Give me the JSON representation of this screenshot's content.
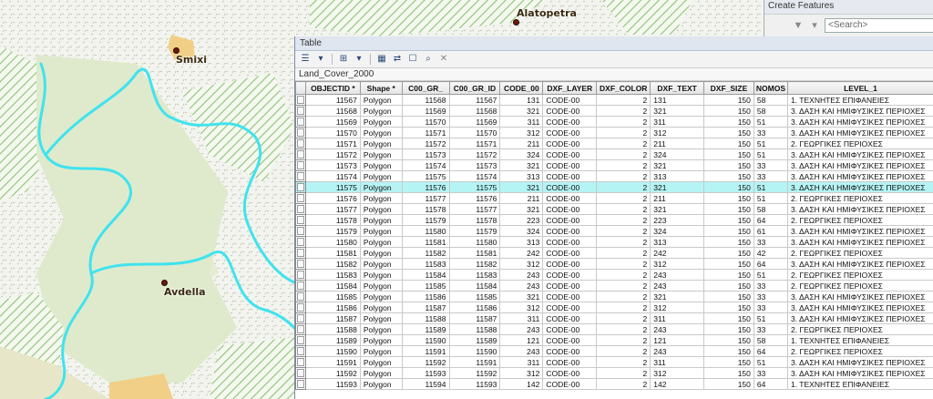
{
  "map": {
    "labels": [
      {
        "name": "Alatopetra"
      },
      {
        "name": "Smixi"
      },
      {
        "name": "Avdella"
      }
    ]
  },
  "create_features": {
    "title": "Create Features",
    "search_placeholder": "<Search>"
  },
  "table_window": {
    "title": "Table",
    "tab_name": "Land_Cover_2000",
    "highlighted_row": 8,
    "columns": [
      "OBJECTID *",
      "Shape *",
      "C00_GR_",
      "C00_GR_ID",
      "CODE_00",
      "DXF_LAYER",
      "DXF_COLOR",
      "DXF_TEXT",
      "DXF_SIZE",
      "NOMOS",
      "LEVEL_1"
    ],
    "rows": [
      [
        "11567",
        "Polygon",
        "11568",
        "11567",
        "131",
        "CODE-00",
        "2",
        "131",
        "150",
        "58",
        "1. ΤΕΧΝΗΤΕΣ ΕΠΙΦΑΝΕΙΕΣ"
      ],
      [
        "11568",
        "Polygon",
        "11569",
        "11568",
        "321",
        "CODE-00",
        "2",
        "321",
        "150",
        "58",
        "3. ΔΑΣΗ ΚΑΙ ΗΜΙΦΥΣΙΚΕΣ ΠΕΡΙΟΧΕΣ"
      ],
      [
        "11569",
        "Polygon",
        "11570",
        "11569",
        "311",
        "CODE-00",
        "2",
        "311",
        "150",
        "51",
        "3. ΔΑΣΗ ΚΑΙ ΗΜΙΦΥΣΙΚΕΣ ΠΕΡΙΟΧΕΣ"
      ],
      [
        "11570",
        "Polygon",
        "11571",
        "11570",
        "312",
        "CODE-00",
        "2",
        "312",
        "150",
        "33",
        "3. ΔΑΣΗ ΚΑΙ ΗΜΙΦΥΣΙΚΕΣ ΠΕΡΙΟΧΕΣ"
      ],
      [
        "11571",
        "Polygon",
        "11572",
        "11571",
        "211",
        "CODE-00",
        "2",
        "211",
        "150",
        "51",
        "2. ΓΕΩΡΓΙΚΕΣ ΠΕΡΙΟΧΕΣ"
      ],
      [
        "11572",
        "Polygon",
        "11573",
        "11572",
        "324",
        "CODE-00",
        "2",
        "324",
        "150",
        "51",
        "3. ΔΑΣΗ ΚΑΙ ΗΜΙΦΥΣΙΚΕΣ ΠΕΡΙΟΧΕΣ"
      ],
      [
        "11573",
        "Polygon",
        "11574",
        "11573",
        "321",
        "CODE-00",
        "2",
        "321",
        "150",
        "33",
        "3. ΔΑΣΗ ΚΑΙ ΗΜΙΦΥΣΙΚΕΣ ΠΕΡΙΟΧΕΣ"
      ],
      [
        "11574",
        "Polygon",
        "11575",
        "11574",
        "313",
        "CODE-00",
        "2",
        "313",
        "150",
        "33",
        "3. ΔΑΣΗ ΚΑΙ ΗΜΙΦΥΣΙΚΕΣ ΠΕΡΙΟΧΕΣ"
      ],
      [
        "11575",
        "Polygon",
        "11576",
        "11575",
        "321",
        "CODE-00",
        "2",
        "321",
        "150",
        "51",
        "3. ΔΑΣΗ ΚΑΙ ΗΜΙΦΥΣΙΚΕΣ ΠΕΡΙΟΧΕΣ"
      ],
      [
        "11576",
        "Polygon",
        "11577",
        "11576",
        "211",
        "CODE-00",
        "2",
        "211",
        "150",
        "51",
        "2. ΓΕΩΡΓΙΚΕΣ ΠΕΡΙΟΧΕΣ"
      ],
      [
        "11577",
        "Polygon",
        "11578",
        "11577",
        "321",
        "CODE-00",
        "2",
        "321",
        "150",
        "58",
        "3. ΔΑΣΗ ΚΑΙ ΗΜΙΦΥΣΙΚΕΣ ΠΕΡΙΟΧΕΣ"
      ],
      [
        "11578",
        "Polygon",
        "11579",
        "11578",
        "223",
        "CODE-00",
        "2",
        "223",
        "150",
        "64",
        "2. ΓΕΩΡΓΙΚΕΣ ΠΕΡΙΟΧΕΣ"
      ],
      [
        "11579",
        "Polygon",
        "11580",
        "11579",
        "324",
        "CODE-00",
        "2",
        "324",
        "150",
        "61",
        "3. ΔΑΣΗ ΚΑΙ ΗΜΙΦΥΣΙΚΕΣ ΠΕΡΙΟΧΕΣ"
      ],
      [
        "11580",
        "Polygon",
        "11581",
        "11580",
        "313",
        "CODE-00",
        "2",
        "313",
        "150",
        "33",
        "3. ΔΑΣΗ ΚΑΙ ΗΜΙΦΥΣΙΚΕΣ ΠΕΡΙΟΧΕΣ"
      ],
      [
        "11581",
        "Polygon",
        "11582",
        "11581",
        "242",
        "CODE-00",
        "2",
        "242",
        "150",
        "42",
        "2. ΓΕΩΡΓΙΚΕΣ ΠΕΡΙΟΧΕΣ"
      ],
      [
        "11582",
        "Polygon",
        "11583",
        "11582",
        "312",
        "CODE-00",
        "2",
        "312",
        "150",
        "64",
        "3. ΔΑΣΗ ΚΑΙ ΗΜΙΦΥΣΙΚΕΣ ΠΕΡΙΟΧΕΣ"
      ],
      [
        "11583",
        "Polygon",
        "11584",
        "11583",
        "243",
        "CODE-00",
        "2",
        "243",
        "150",
        "51",
        "2. ΓΕΩΡΓΙΚΕΣ ΠΕΡΙΟΧΕΣ"
      ],
      [
        "11584",
        "Polygon",
        "11585",
        "11584",
        "243",
        "CODE-00",
        "2",
        "243",
        "150",
        "33",
        "2. ΓΕΩΡΓΙΚΕΣ ΠΕΡΙΟΧΕΣ"
      ],
      [
        "11585",
        "Polygon",
        "11586",
        "11585",
        "321",
        "CODE-00",
        "2",
        "321",
        "150",
        "33",
        "3. ΔΑΣΗ ΚΑΙ ΗΜΙΦΥΣΙΚΕΣ ΠΕΡΙΟΧΕΣ"
      ],
      [
        "11586",
        "Polygon",
        "11587",
        "11586",
        "312",
        "CODE-00",
        "2",
        "312",
        "150",
        "33",
        "3. ΔΑΣΗ ΚΑΙ ΗΜΙΦΥΣΙΚΕΣ ΠΕΡΙΟΧΕΣ"
      ],
      [
        "11587",
        "Polygon",
        "11588",
        "11587",
        "311",
        "CODE-00",
        "2",
        "311",
        "150",
        "51",
        "3. ΔΑΣΗ ΚΑΙ ΗΜΙΦΥΣΙΚΕΣ ΠΕΡΙΟΧΕΣ"
      ],
      [
        "11588",
        "Polygon",
        "11589",
        "11588",
        "243",
        "CODE-00",
        "2",
        "243",
        "150",
        "33",
        "2. ΓΕΩΡΓΙΚΕΣ ΠΕΡΙΟΧΕΣ"
      ],
      [
        "11589",
        "Polygon",
        "11590",
        "11589",
        "121",
        "CODE-00",
        "2",
        "121",
        "150",
        "58",
        "1. ΤΕΧΝΗΤΕΣ ΕΠΙΦΑΝΕΙΕΣ"
      ],
      [
        "11590",
        "Polygon",
        "11591",
        "11590",
        "243",
        "CODE-00",
        "2",
        "243",
        "150",
        "64",
        "2. ΓΕΩΡΓΙΚΕΣ ΠΕΡΙΟΧΕΣ"
      ],
      [
        "11591",
        "Polygon",
        "11592",
        "11591",
        "311",
        "CODE-00",
        "2",
        "311",
        "150",
        "51",
        "3. ΔΑΣΗ ΚΑΙ ΗΜΙΦΥΣΙΚΕΣ ΠΕΡΙΟΧΕΣ"
      ],
      [
        "11592",
        "Polygon",
        "11593",
        "11592",
        "312",
        "CODE-00",
        "2",
        "312",
        "150",
        "33",
        "3. ΔΑΣΗ ΚΑΙ ΗΜΙΦΥΣΙΚΕΣ ΠΕΡΙΟΧΕΣ"
      ],
      [
        "11593",
        "Polygon",
        "11594",
        "11593",
        "142",
        "CODE-00",
        "2",
        "142",
        "150",
        "64",
        "1. ΤΕΧΝΗΤΕΣ ΕΠΙΦΑΝΕΙΕΣ"
      ]
    ]
  }
}
